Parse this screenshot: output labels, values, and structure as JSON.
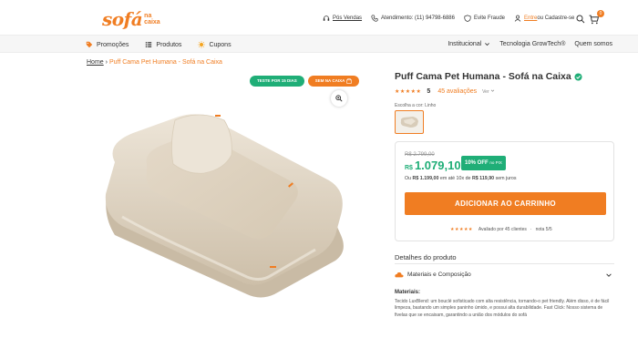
{
  "header": {
    "logo_main": "sofá",
    "logo_sub_1": "na",
    "logo_sub_2": "caixa",
    "pos_vendas": "Pós Vendas",
    "atendimento": "Atendimento: (11) 94798-6886",
    "evite_fraude": "Evite Fraude",
    "entre": "Entre",
    "cadastre": " ou Cadastre-se",
    "cart_count": "0"
  },
  "nav": {
    "left": [
      "Promoções",
      "Produtos",
      "Cupons"
    ],
    "right": [
      "Institucional",
      "Tecnologia GrowTech®",
      "Quem somos"
    ]
  },
  "breadcrumb": {
    "home": "Home",
    "separator": "›",
    "current": "Puff Cama Pet Humana - Sofá na Caixa"
  },
  "badges": {
    "trial": "TESTE POR 15 DIAS",
    "box": "SEM NA CAIXA"
  },
  "product": {
    "title": "Puff Cama Pet Humana - Sofá na Caixa",
    "stars": "★★★★★",
    "score": "5",
    "reviews": "45 avaliações",
    "see": "Ver",
    "color_label": "Escolha a cor: Linho",
    "color_value": "Linho"
  },
  "price": {
    "old": "R$ 2.799,00",
    "currency": "R$",
    "new": "1.079,10",
    "discount": "10% OFF",
    "discount_suffix": "no PIX",
    "installments_prefix": "Ou ",
    "installments_full": "R$ 1.199,00",
    "installments_mid": " em até 10x de ",
    "installments_value": "R$ 119,90",
    "installments_suffix": " sem juros",
    "add_to_cart": "ADICIONAR AO CARRINHO",
    "review_stars": "★★★★★",
    "review_text": "Avaliado por 45 clientes",
    "review_sep": "·",
    "review_score": "nota 5/5"
  },
  "details": {
    "title": "Detalhes do produto",
    "accordion_label": "Materiais e Composição",
    "body_heading": "Materiais:",
    "body_text": "Tecido LuxBlend: um bouclé sofisticado com alta resistência, tornando-o pet friendly. Além disso, é de fácil limpeza, bastando um simples paninho úmido, e possui alta durabilidade. Fast Click: Nosso sistema de fivelas que se encaixam, garantindo a união dos módulos do sofá"
  },
  "colors": {
    "brand_orange": "#f07d22",
    "green": "#1fae77",
    "product_beige": "#e6dccd"
  }
}
